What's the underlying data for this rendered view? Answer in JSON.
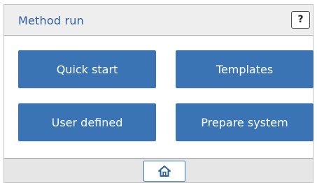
{
  "header": {
    "title": "Method run",
    "help_label": "?"
  },
  "tiles": [
    {
      "label": "Quick start"
    },
    {
      "label": "Templates"
    },
    {
      "label": "User defined"
    },
    {
      "label": "Prepare system"
    }
  ],
  "footer": {
    "home_icon": "home-icon"
  },
  "colors": {
    "accent": "#3a74b4",
    "title_text": "#2d5f9e",
    "header_bg": "#eeeeee",
    "footer_bg": "#e6e6e6"
  }
}
